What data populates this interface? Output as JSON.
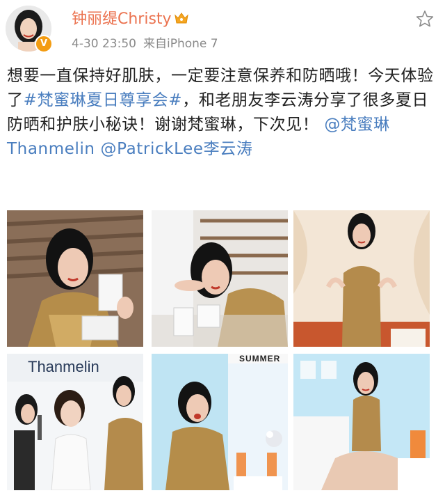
{
  "post": {
    "author": {
      "name": "钟丽缇Christy",
      "verified_mark": "V",
      "crown_icon": "crown-icon",
      "avatar_icon": "avatar"
    },
    "timestamp": "4-30 23:50",
    "source": "来自iPhone 7",
    "favorite_icon": "star-outline-icon",
    "text": {
      "part1": "想要一直保持好肌肤，一定要注意保养和防晒哦！今天体验了",
      "topic": "#梵蜜琳夏日尊享会#",
      "part2": "，和老朋友李云涛分享了很多夏日防晒和护肤小秘诀！谢谢梵蜜琳，下次见！",
      "mention1": "@梵蜜琳Thanmelin",
      "mention2": "@PatrickLee李云涛"
    },
    "photos": [
      {
        "alt": "photo-1"
      },
      {
        "alt": "photo-2"
      },
      {
        "alt": "photo-3"
      },
      {
        "alt": "photo-4",
        "sign": "Thanmelin"
      },
      {
        "alt": "photo-5",
        "sign": "SUMMER"
      },
      {
        "alt": "photo-6"
      }
    ]
  },
  "colors": {
    "username": "#eb7350",
    "link": "#4a7ebf",
    "meta": "#8a8a8a",
    "verified": "#f39c12"
  }
}
